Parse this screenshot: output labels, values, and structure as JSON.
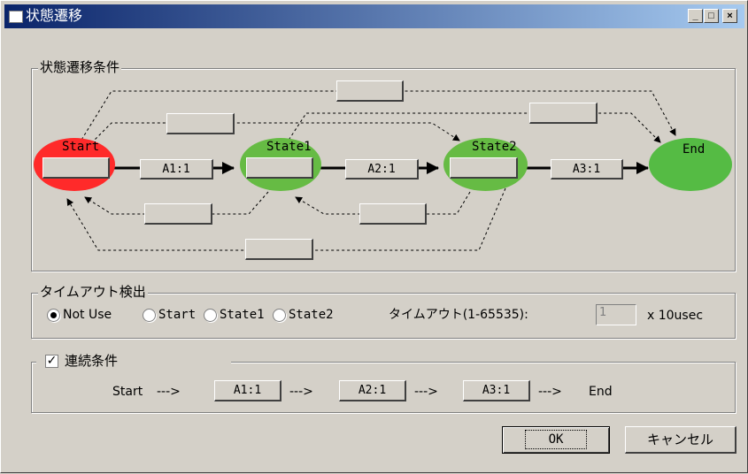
{
  "window": {
    "title": "状態遷移",
    "btn_min": "_",
    "btn_max": "□",
    "btn_close": "×"
  },
  "transition_group": {
    "legend": "状態遷移条件",
    "states": {
      "start": "Start",
      "state1": "State1",
      "state2": "State2",
      "end": "End"
    },
    "buttons": {
      "a1": "A1:1",
      "a2": "A2:1",
      "a3": "A3:1"
    },
    "colors": {
      "start": "#ff2a2a",
      "state": "#66bb44",
      "end": "#55bb44"
    }
  },
  "timeout_group": {
    "legend": "タイムアウト検出",
    "options": [
      "Not Use",
      "Start",
      "State1",
      "State2"
    ],
    "selected": "Not Use",
    "timeout_label": "タイムアウト(1-65535):",
    "timeout_value": "1",
    "unit": "x 10usec"
  },
  "sequence_group": {
    "legend": "連続条件",
    "checked": true,
    "start": "Start",
    "arrow": "--->",
    "steps": [
      "A1:1",
      "A2:1",
      "A3:1"
    ],
    "end": "End"
  },
  "footer": {
    "ok": "OK",
    "cancel": "キャンセル"
  }
}
